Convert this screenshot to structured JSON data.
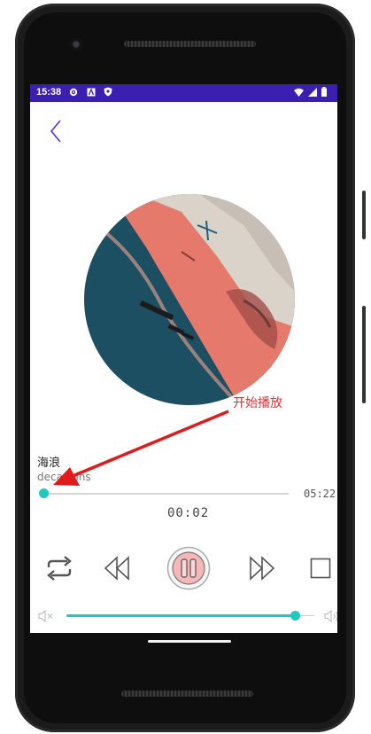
{
  "status_bar": {
    "time": "15:38",
    "icons": [
      "gear-icon",
      "a-icon",
      "shield-icon",
      "wifi-icon",
      "signal-icon",
      "battery-icon"
    ]
  },
  "player": {
    "annotation": "开始播放",
    "title": "海浪",
    "artist": "deca joins",
    "total_time": "05:22",
    "current_time": "00:02",
    "progress_fraction": 0.006,
    "volume_fraction": 0.96,
    "accent_color": "#1ec9c0",
    "annotation_color": "#e53030",
    "status_bar_color": "#3a1fb0"
  },
  "controls": [
    "repeat-icon",
    "rewind-icon",
    "pause-icon",
    "fast-forward-icon",
    "stop-icon"
  ]
}
